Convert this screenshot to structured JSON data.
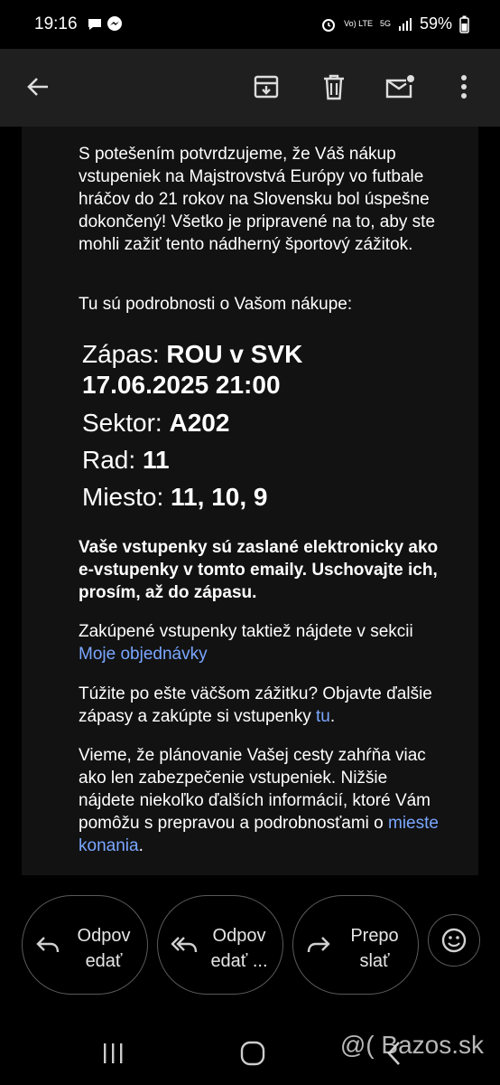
{
  "status": {
    "time": "19:16",
    "network_small": "Vo) LTE",
    "network_5g": "5G",
    "battery": "59%"
  },
  "email": {
    "intro": "S potešením potvrdzujeme, že Váš nákup vstupeniek na Majstrovstvá Európy vo futbale hráčov do 21 rokov na Slovensku bol úspešne dokončený! Všetko je pripravené na to, aby ste mohli zažiť tento nádherný športový zážitok.",
    "details_intro": "Tu sú podrobnosti o Vašom nákupe:",
    "details": {
      "match_label": "Zápas:",
      "match_value": "ROU v SVK",
      "datetime": "17.06.2025 21:00",
      "sector_label": "Sektor:",
      "sector_value": "A202",
      "row_label": "Rad:",
      "row_value": "11",
      "seat_label": "Miesto:",
      "seat_value": "11, 10, 9"
    },
    "eticket_note": "Vaše vstupenky sú zaslané elektronicky ako e-vstupenky v tomto emaily. Uschovajte ich, prosím, až do zápasu.",
    "orders_text": "Zakúpené vstupenky taktiež nájdete v sekcii",
    "orders_link": "Moje objednávky",
    "more_text": "Túžite po ešte väčšom zážitku? Objavte ďalšie zápasy a zakúpte si vstupenky",
    "more_link": "tu",
    "travel_text": "Vieme, že plánovanie Vašej cesty zahŕňa viac ako len zabezpečenie vstupeniek. Nižšie nájdete niekoľko ďalších informácií, ktoré Vám pomôžu s prepravou a podrobnosťami o",
    "travel_link": "mieste konania"
  },
  "actions": {
    "reply": "Odpov edať",
    "reply_all": "Odpov edať ...",
    "forward": "Prepo slať"
  },
  "watermark": "@( Bazos.sk",
  "colors": {
    "link": "#7aa7ff",
    "appbar": "#1f1f1f",
    "content_bg": "#121212"
  }
}
